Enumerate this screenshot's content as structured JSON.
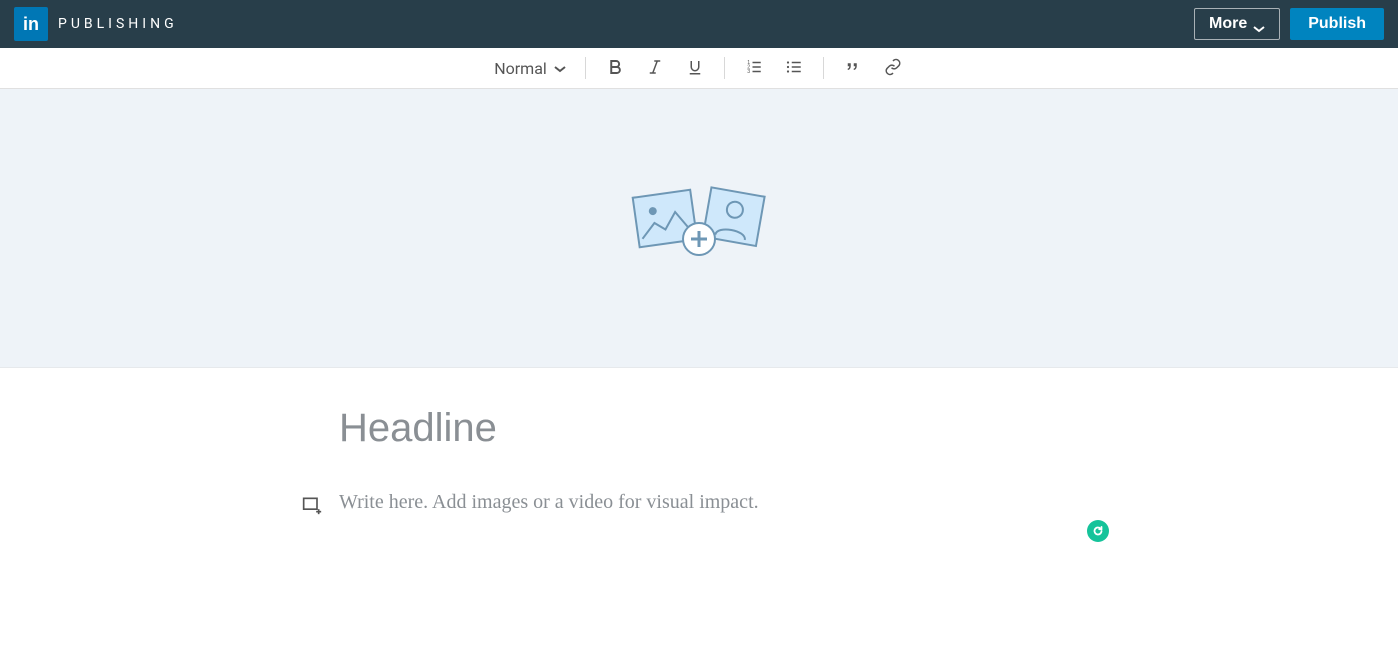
{
  "header": {
    "logo_text": "in",
    "brand_label": "PUBLISHING",
    "more_label": "More",
    "publish_label": "Publish"
  },
  "toolbar": {
    "style_label": "Normal"
  },
  "editor": {
    "headline_placeholder": "Headline",
    "body_placeholder": "Write here. Add images or a video for visual impact."
  }
}
